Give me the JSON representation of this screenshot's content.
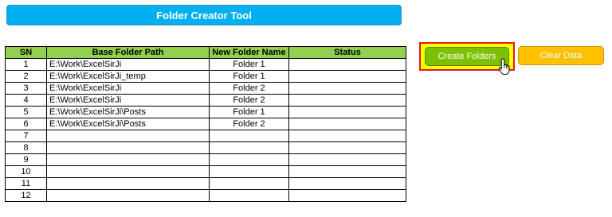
{
  "title": "Folder Creator Tool",
  "table": {
    "headers": [
      "SN",
      "Base Folder Path",
      "New Folder Name",
      "Status"
    ],
    "rows": [
      {
        "sn": "1",
        "path": "E:\\Work\\ExcelSirJi",
        "name": "Folder 1",
        "status": ""
      },
      {
        "sn": "2",
        "path": "E:\\Work\\ExcelSirJi_temp",
        "name": "Folder 1",
        "status": ""
      },
      {
        "sn": "3",
        "path": "E:\\Work\\ExcelSirJi",
        "name": "Folder 2",
        "status": ""
      },
      {
        "sn": "4",
        "path": "E:\\Work\\ExcelSirJi",
        "name": "Folder 2",
        "status": ""
      },
      {
        "sn": "5",
        "path": "E:\\Work\\ExcelSirJi\\Posts",
        "name": "Folder 1",
        "status": ""
      },
      {
        "sn": "6",
        "path": "E:\\Work\\ExcelSirJi\\Posts",
        "name": "Folder 2",
        "status": ""
      },
      {
        "sn": "7",
        "path": "",
        "name": "",
        "status": ""
      },
      {
        "sn": "8",
        "path": "",
        "name": "",
        "status": ""
      },
      {
        "sn": "9",
        "path": "",
        "name": "",
        "status": ""
      },
      {
        "sn": "10",
        "path": "",
        "name": "",
        "status": ""
      },
      {
        "sn": "11",
        "path": "",
        "name": "",
        "status": ""
      },
      {
        "sn": "12",
        "path": "",
        "name": "",
        "status": ""
      }
    ]
  },
  "buttons": {
    "create_label": "Create Folders",
    "clear_label": "Clear Data"
  },
  "colors": {
    "title_bg": "#00b0f0",
    "header_bg": "#92d050",
    "create_bg": "#7cc000",
    "clear_bg": "#ffc000",
    "highlight_border": "#e21a1a",
    "highlight_fill": "#ffff00"
  },
  "icons": {
    "cursor": "hand-pointer-icon"
  }
}
